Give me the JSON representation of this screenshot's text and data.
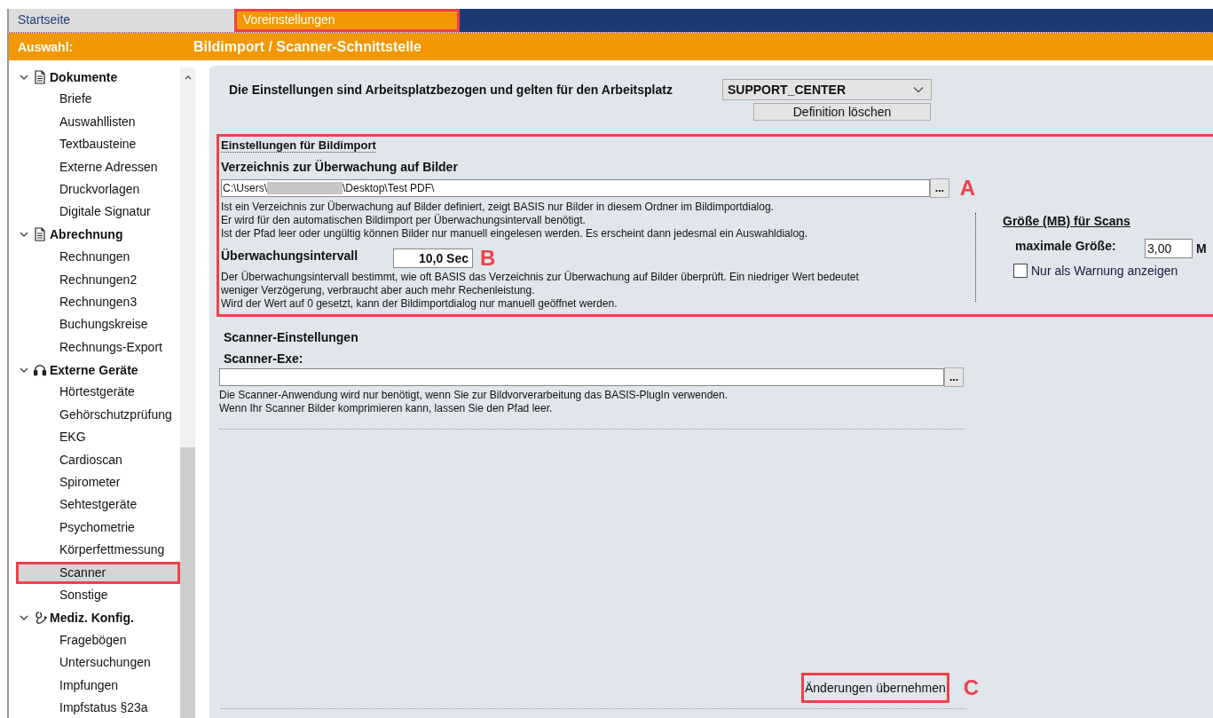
{
  "tabs": [
    {
      "label": "Startseite",
      "selected": false,
      "highlighted": false
    },
    {
      "label": "Voreinstellungen",
      "selected": true,
      "highlighted": true
    }
  ],
  "header": {
    "label": "Auswahl:",
    "title": "Bildimport / Scanner-Schnittstelle"
  },
  "sidebar": {
    "items": [
      {
        "label": "Dokumente",
        "kind": "document",
        "expanded": true,
        "children": [
          {
            "label": "Briefe",
            "selected": false,
            "highlighted": false
          },
          {
            "label": "Auswahllisten",
            "selected": false,
            "highlighted": false
          },
          {
            "label": "Textbausteine",
            "selected": false,
            "highlighted": false
          },
          {
            "label": "Externe Adressen",
            "selected": false,
            "highlighted": false
          },
          {
            "label": "Druckvorlagen",
            "selected": false,
            "highlighted": false
          },
          {
            "label": "Digitale Signatur",
            "selected": false,
            "highlighted": false
          }
        ]
      },
      {
        "label": "Abrechnung",
        "kind": "document",
        "expanded": true,
        "children": [
          {
            "label": "Rechnungen",
            "selected": false,
            "highlighted": false
          },
          {
            "label": "Rechnungen2",
            "selected": false,
            "highlighted": false
          },
          {
            "label": "Rechnungen3",
            "selected": false,
            "highlighted": false
          },
          {
            "label": "Buchungskreise",
            "selected": false,
            "highlighted": false
          },
          {
            "label": "Rechnungs-Export",
            "selected": false,
            "highlighted": false
          }
        ]
      },
      {
        "label": "Externe Geräte",
        "kind": "headphones",
        "expanded": true,
        "children": [
          {
            "label": "Hörtestgeräte",
            "selected": false,
            "highlighted": false
          },
          {
            "label": "Gehörschutzprüfung",
            "selected": false,
            "highlighted": false
          },
          {
            "label": "EKG",
            "selected": false,
            "highlighted": false
          },
          {
            "label": "Cardioscan",
            "selected": false,
            "highlighted": false
          },
          {
            "label": "Spirometer",
            "selected": false,
            "highlighted": false
          },
          {
            "label": "Sehtestgeräte",
            "selected": false,
            "highlighted": false
          },
          {
            "label": "Psychometrie",
            "selected": false,
            "highlighted": false
          },
          {
            "label": "Körperfettmessung",
            "selected": false,
            "highlighted": false
          },
          {
            "label": "Scanner",
            "selected": true,
            "highlighted": true
          },
          {
            "label": "Sonstige",
            "selected": false,
            "highlighted": false
          }
        ]
      },
      {
        "label": "Mediz. Konfig.",
        "kind": "stethoscope",
        "expanded": true,
        "children": [
          {
            "label": "Fragebögen",
            "selected": false,
            "highlighted": false
          },
          {
            "label": "Untersuchungen",
            "selected": false,
            "highlighted": false
          },
          {
            "label": "Impfungen",
            "selected": false,
            "highlighted": false
          },
          {
            "label": "Impfstatus §23a",
            "selected": false,
            "highlighted": false
          }
        ]
      }
    ]
  },
  "workplace": {
    "label": "Die Einstellungen sind Arbeitsplatzbezogen und gelten für den Arbeitsplatz",
    "value": "SUPPORT_CENTER",
    "delete_button": "Definition löschen"
  },
  "image_import": {
    "highlighted": true,
    "title": "Einstellungen für Bildimport",
    "folder_label": "Verzeichnis zur Überwachung auf Bilder",
    "folder_path_start": "C:\\Users\\",
    "folder_path_redacted": true,
    "folder_path_end": "\\Desktop\\Test PDF\\",
    "browse_button": "...",
    "folder_callout": "A",
    "folder_help": [
      "Ist ein Verzeichnis zur Überwachung auf Bilder definiert, zeigt BASIS nur Bilder in diesem Ordner im Bildimportdialog.",
      "Er wird für den automatischen Bildimport per Überwachungsintervall benötigt.",
      "Ist der Pfad leer oder ungültig können Bilder nur manuell eingelesen werden. Es erscheint dann jedesmal ein Auswahldialog."
    ],
    "interval_label": "Überwachungsintervall",
    "interval_value": "10,0 Sec",
    "interval_callout": "B",
    "interval_help": [
      "Der Überwachungsintervall bestimmt, wie oft BASIS das  Verzeichnis zur Überwachung auf Bilder überprüft. Ein niedriger Wert bedeutet",
      "weniger Verzögerung, verbraucht aber auch mehr Rechenleistung.",
      "Wird der Wert auf 0 gesetzt, kann der Bildimportdialog nur manuell geöffnet werden."
    ],
    "size_title": "Größe (MB) für Scans",
    "max_size_label": "maximale Größe:",
    "max_size_value": "3,00",
    "max_size_unit": "M",
    "warning_only": {
      "label": "Nur als Warnung anzeigen",
      "checked": false
    }
  },
  "scanner": {
    "title": "Scanner-Einstellungen",
    "exe_label": "Scanner-Exe:",
    "browse_button": "...",
    "help": [
      "Die Scanner-Anwendung wird nur benötigt, wenn Sie zur Bildvorverarbeitung das BASIS-PlugIn verwenden.",
      "Wenn Ihr Scanner Bilder komprimieren kann, lassen Sie den Pfad leer."
    ]
  },
  "apply_button": {
    "label": "Änderungen übernehmen",
    "highlighted": true,
    "callout": "C"
  }
}
